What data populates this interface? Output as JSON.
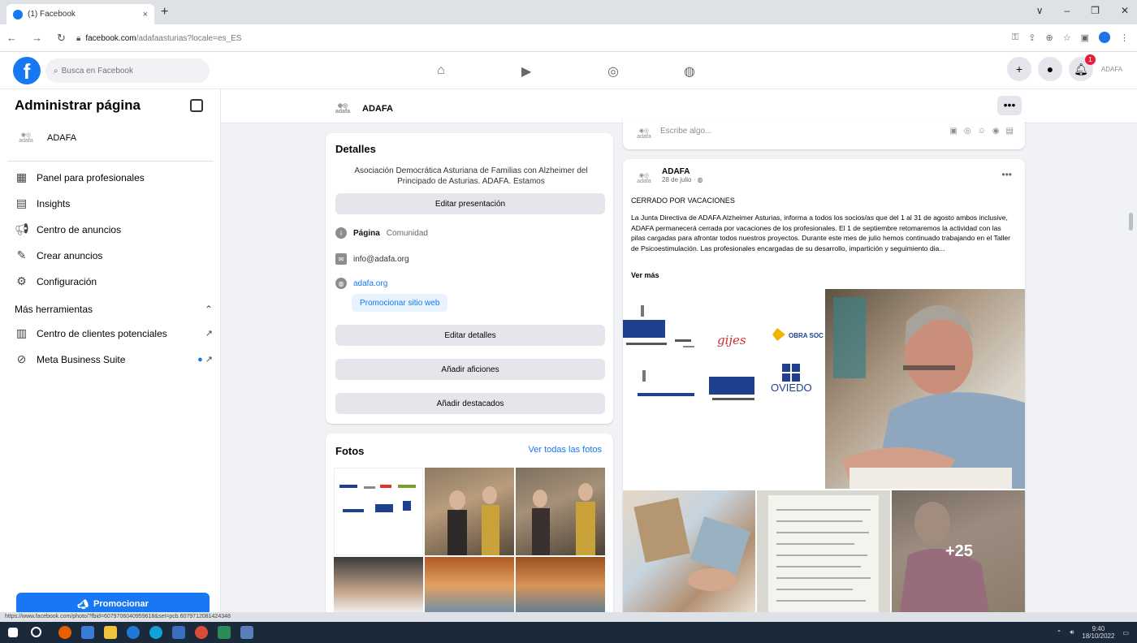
{
  "browser": {
    "tab_title": "(1) Facebook",
    "tab_close": "×",
    "new_tab": "+",
    "url_host": "facebook.com",
    "url_path": "/adafaasturias?locale=es_ES",
    "window_controls": [
      "∨",
      "–",
      "❐",
      "✕"
    ]
  },
  "fb": {
    "search_placeholder": "Busca en Facebook",
    "colors": {
      "brand": "#1877f2",
      "badge": "#e41e3f",
      "page_bg": "#f0f2f5"
    },
    "nav_icons": [
      "home-icon",
      "video-icon",
      "marketplace-icon",
      "gaming-icon"
    ],
    "notifications_count": "1"
  },
  "sidebar": {
    "title": "Administrar página",
    "page_name": "ADAFA",
    "items": [
      {
        "label": "Panel para profesionales",
        "icon": "dashboard-icon"
      },
      {
        "label": "Insights",
        "icon": "insights-icon"
      },
      {
        "label": "Centro de anuncios",
        "icon": "megaphone-icon"
      },
      {
        "label": "Crear anuncios",
        "icon": "edit-icon"
      },
      {
        "label": "Configuración",
        "icon": "gear-icon"
      }
    ],
    "more_tools": "Más herramientas",
    "tools": [
      {
        "label": "Centro de clientes potenciales",
        "icon": "leads-icon"
      },
      {
        "label": "Meta Business Suite",
        "icon": "meta-icon"
      }
    ],
    "promote": "Promocionar"
  },
  "pagebar": {
    "name": "ADAFA",
    "more": "•••"
  },
  "details": {
    "title": "Detalles",
    "description": "Asociación Democrática Asturiana de Familias con Alzheimer del Principado de Asturias. ADAFA. Estamos",
    "edit_presentation": "Editar presentación",
    "page_label": "Página",
    "page_category": "Comunidad",
    "email": "info@adafa.org",
    "website": "adafa.org",
    "promote_site": "Promocionar sitio web",
    "edit_details": "Editar detalles",
    "add_hobbies": "Añadir aficiones",
    "add_featured": "Añadir destacados"
  },
  "photos": {
    "title": "Fotos",
    "see_all": "Ver todas las fotos"
  },
  "composer": {
    "placeholder": "Escribe algo..."
  },
  "post": {
    "author": "ADAFA",
    "date": "28 de julio",
    "headline": "CERRADO POR VACACIONES",
    "body": "La Junta Directiva de ADAFA Alzheimer Asturias, informa a todos los socios/as que del 1 al 31 de agosto ambos inclusive, ADAFA permanecerá cerrada por vacaciones de los profesionales. El 1 de septiembre retomaremos la actividad con las pilas cargadas para afrontar todos nuestros proyectos. Durante este mes de julio hemos continuado trabajando en el Taller de Psicoestimulación. Las profesionales encargadas de su desarrollo, impartición y seguimiento dia...",
    "see_more": "Ver más",
    "more_photos": "+25",
    "logo_text": "OVIEDO"
  },
  "statusbar": {
    "url": "https://www.facebook.com/photo/?fbid=6079706040959618&set=pcb.6079712081424348"
  },
  "taskbar": {
    "time": "9:40",
    "date": "18/10/2022"
  }
}
